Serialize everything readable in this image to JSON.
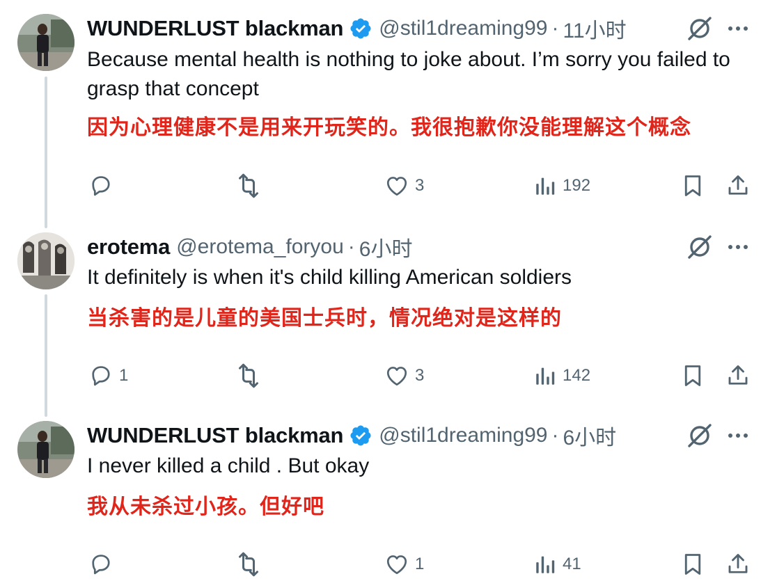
{
  "colors": {
    "text_primary": "#0f1419",
    "text_secondary": "#536471",
    "translation_red": "#e0251b",
    "verified_blue": "#1d9bf0",
    "thread_line": "#cfd9de"
  },
  "tweets": [
    {
      "display_name": "WUNDERLUST blackman",
      "verified": true,
      "handle": "@stil1dreaming99",
      "separator": "·",
      "time": "11小时",
      "text": "Because mental health is nothing to joke about. I’m sorry you failed to grasp that concept",
      "translation": "因为心理健康不是用来开玩笑的。我很抱歉你没能理解这个概念",
      "stats": {
        "replies": "",
        "retweets": "",
        "likes": "3",
        "views": "192"
      },
      "icons": [
        "reply-icon",
        "retweet-icon",
        "like-icon",
        "views-icon",
        "bookmark-icon",
        "share-icon",
        "grok-icon",
        "more-icon"
      ]
    },
    {
      "display_name": "erotema",
      "verified": false,
      "handle": "@erotema_foryou",
      "separator": "·",
      "time": "6小时",
      "text": "It definitely is when it's child killing American soldiers",
      "translation": "当杀害的是儿童的美国士兵时，情况绝对是这样的",
      "stats": {
        "replies": "1",
        "retweets": "",
        "likes": "3",
        "views": "142"
      },
      "icons": [
        "reply-icon",
        "retweet-icon",
        "like-icon",
        "views-icon",
        "bookmark-icon",
        "share-icon",
        "grok-icon",
        "more-icon"
      ]
    },
    {
      "display_name": "WUNDERLUST blackman",
      "verified": true,
      "handle": "@stil1dreaming99",
      "separator": "·",
      "time": "6小时",
      "text": "I never killed a child . But okay",
      "translation": "我从未杀过小孩。但好吧",
      "stats": {
        "replies": "",
        "retweets": "",
        "likes": "1",
        "views": "41"
      },
      "icons": [
        "reply-icon",
        "retweet-icon",
        "like-icon",
        "views-icon",
        "bookmark-icon",
        "share-icon",
        "grok-icon",
        "more-icon"
      ]
    }
  ]
}
